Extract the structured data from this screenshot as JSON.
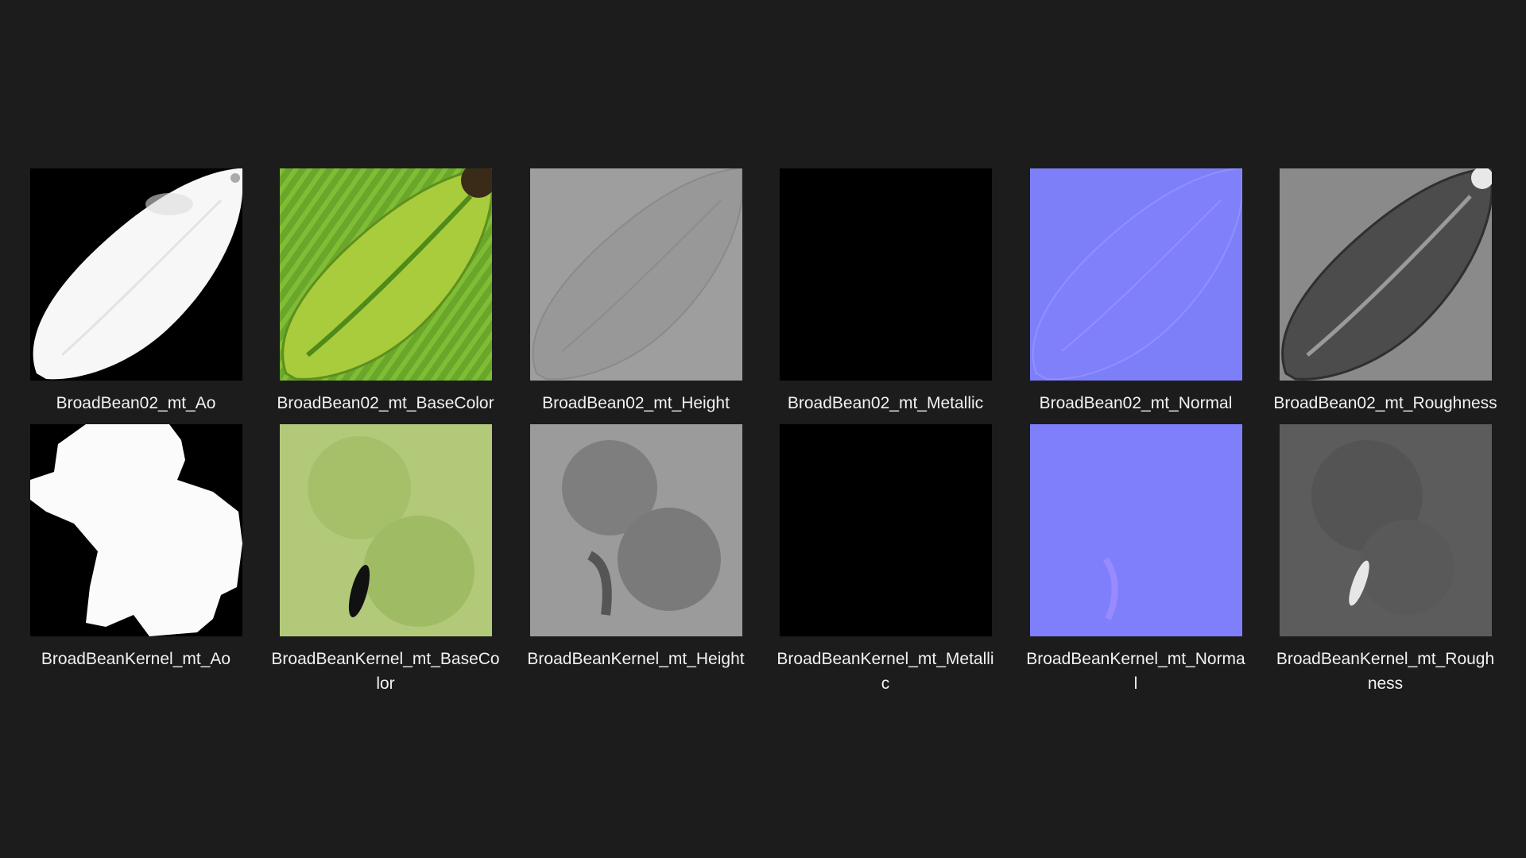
{
  "files": [
    {
      "name": "BroadBean02_mt_Ao",
      "kind": "ao-leaf"
    },
    {
      "name": "BroadBean02_mt_BaseColor",
      "kind": "basecolor-leaf"
    },
    {
      "name": "BroadBean02_mt_Height",
      "kind": "height-leaf"
    },
    {
      "name": "BroadBean02_mt_Metallic",
      "kind": "metallic"
    },
    {
      "name": "BroadBean02_mt_Normal",
      "kind": "normal-leaf"
    },
    {
      "name": "BroadBean02_mt_Roughness",
      "kind": "roughness-leaf"
    },
    {
      "name": "BroadBeanKernel_mt_Ao",
      "kind": "ao-kernel"
    },
    {
      "name": "BroadBeanKernel_mt_BaseCo\nlor",
      "kind": "basecolor-kernel"
    },
    {
      "name": "BroadBeanKernel_mt_Height",
      "kind": "height-kernel"
    },
    {
      "name": "BroadBeanKernel_mt_Metalli\nc",
      "kind": "metallic"
    },
    {
      "name": "BroadBeanKernel_mt_Norma\nl",
      "kind": "normal-kernel"
    },
    {
      "name": "BroadBeanKernel_mt_Rough\nness",
      "kind": "roughness-kernel"
    }
  ],
  "colors": {
    "background": "#1c1c1c",
    "label": "#f2f2f2",
    "normal": "#7f7ffb",
    "basecolor_green": "#8cbf3a"
  }
}
